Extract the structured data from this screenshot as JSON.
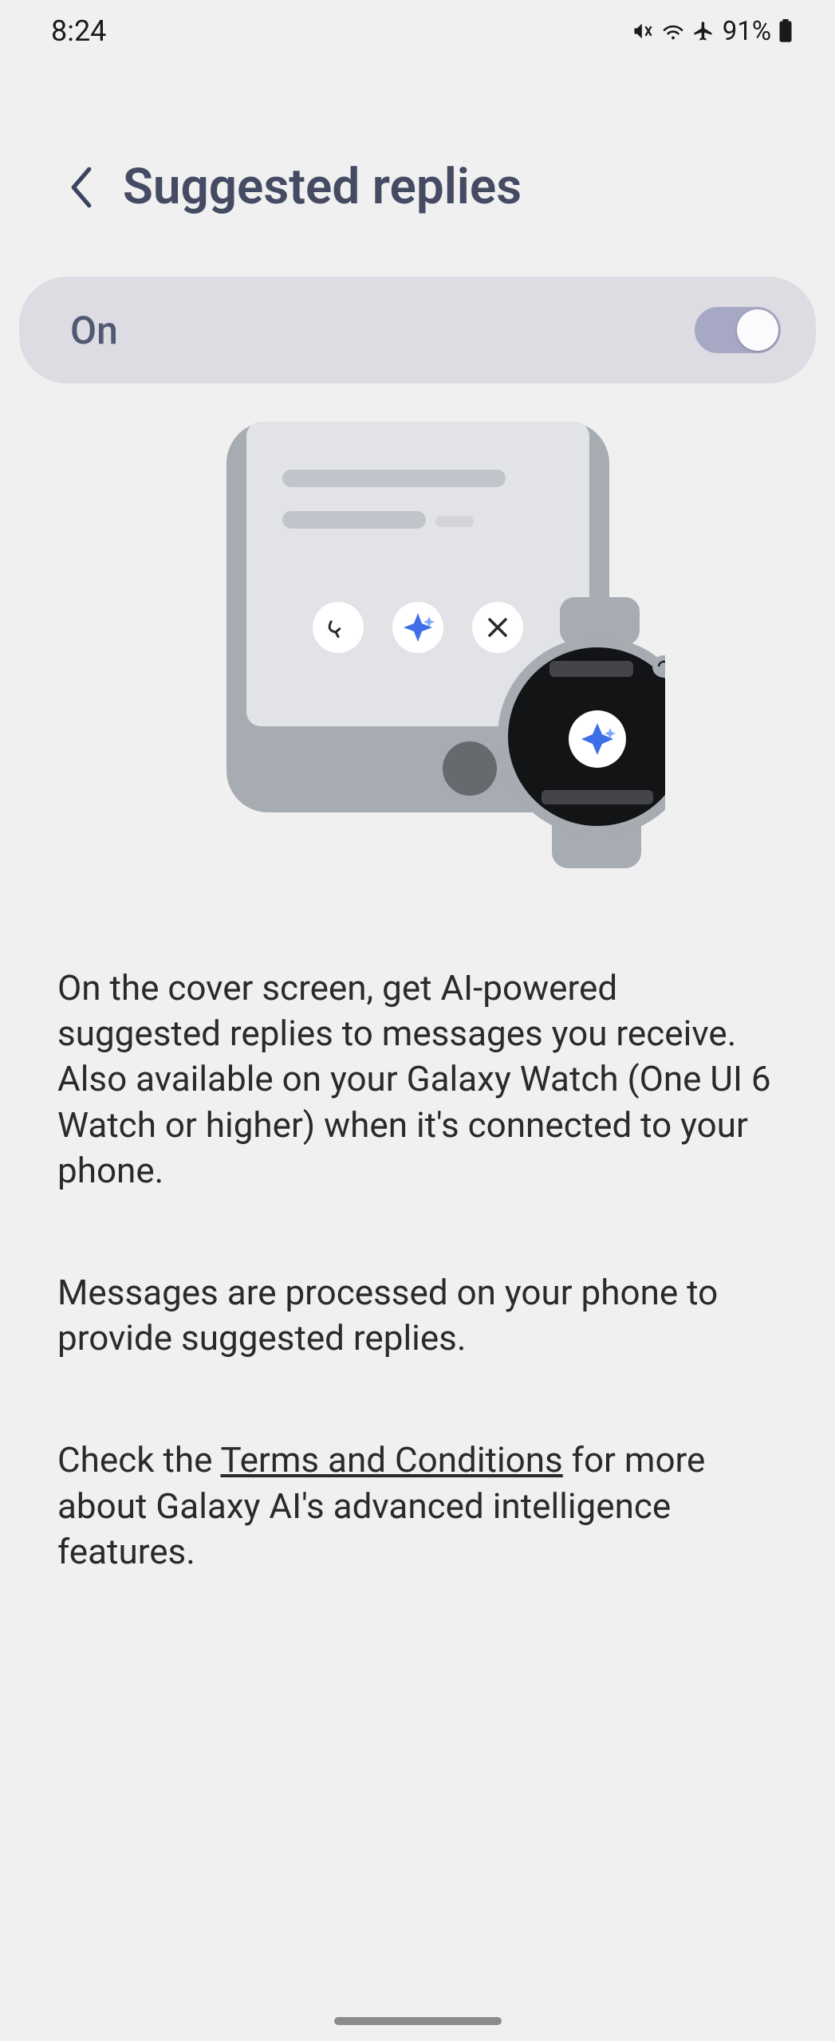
{
  "status": {
    "time": "8:24",
    "battery_pct": "91%"
  },
  "header": {
    "title": "Suggested replies"
  },
  "toggle": {
    "label": "On",
    "state": "on"
  },
  "body": {
    "p1": "On the cover screen, get AI-powered suggested replies to messages you receive. Also available on your Galaxy Watch (One UI 6 Watch or higher) when it's connected to your phone.",
    "p2": "Messages are processed on your phone to provide suggested replies.",
    "p3_pre": "Check the ",
    "p3_link": "Terms and Conditions",
    "p3_post": " for more about Galaxy AI's advanced intelligence features."
  }
}
